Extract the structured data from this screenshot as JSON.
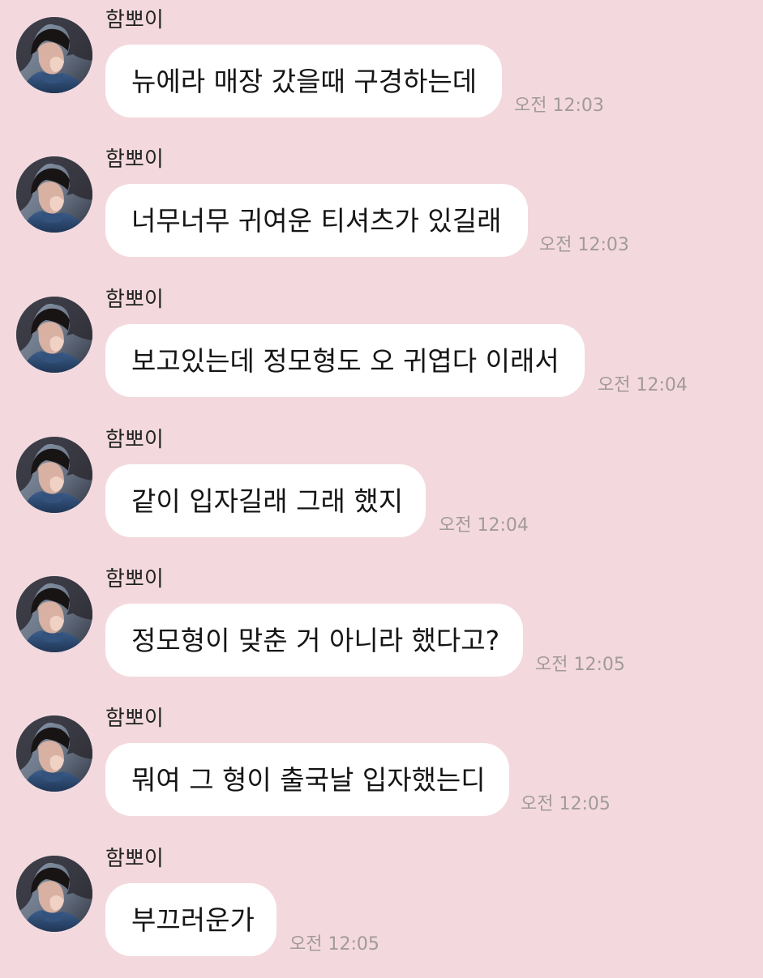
{
  "chat": {
    "background_color": "#f3d9de",
    "bubble_color": "#ffffff",
    "messages": [
      {
        "sender": "함뽀이",
        "text": "뉴에라 매장 갔을때 구경하는데",
        "time": "오전 12:03"
      },
      {
        "sender": "함뽀이",
        "text": "너무너무 귀여운 티셔츠가 있길래",
        "time": "오전 12:03"
      },
      {
        "sender": "함뽀이",
        "text": "보고있는데 정모형도 오 귀엽다 이래서",
        "time": "오전 12:04"
      },
      {
        "sender": "함뽀이",
        "text": "같이 입자길래 그래 했지",
        "time": "오전 12:04"
      },
      {
        "sender": "함뽀이",
        "text": "정모형이 맞춘 거 아니라 했다고?",
        "time": "오전 12:05"
      },
      {
        "sender": "함뽀이",
        "text": "뭐여 그 형이 출국날 입자했는디",
        "time": "오전 12:05"
      },
      {
        "sender": "함뽀이",
        "text": "부끄러운가",
        "time": "오전 12:05"
      }
    ]
  }
}
